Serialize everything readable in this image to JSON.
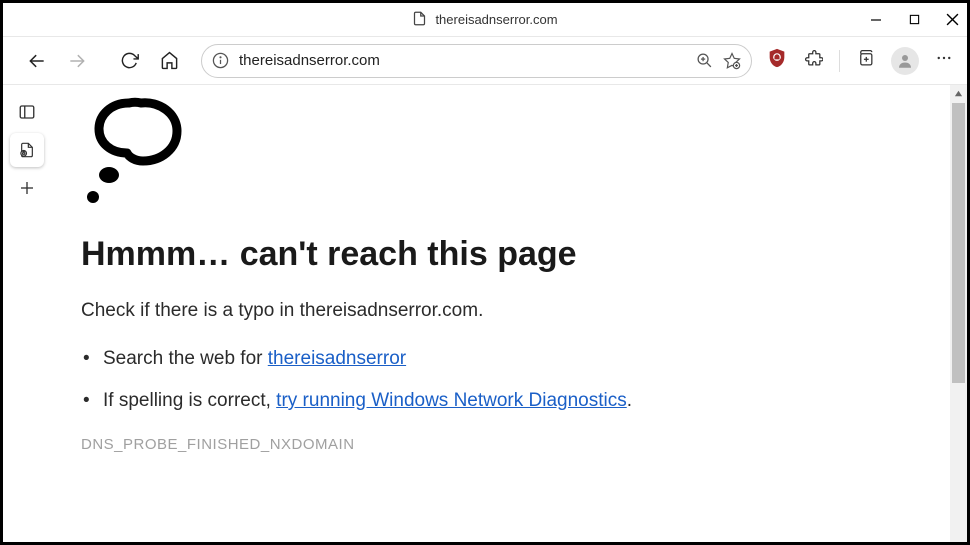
{
  "titlebar": {
    "domain": "thereisadnserror.com"
  },
  "toolbar": {
    "url": "thereisadnserror.com"
  },
  "error": {
    "title": "Hmmm… can't reach this page",
    "subtitle": "Check if there is a typo in thereisadnserror.com.",
    "suggestions": {
      "search_prefix": "Search the web for ",
      "search_link": "thereisadnserror",
      "spelling_prefix": "If spelling is correct, ",
      "diagnostics_link": "try running Windows Network Diagnostics",
      "period": "."
    },
    "code": "DNS_PROBE_FINISHED_NXDOMAIN"
  }
}
